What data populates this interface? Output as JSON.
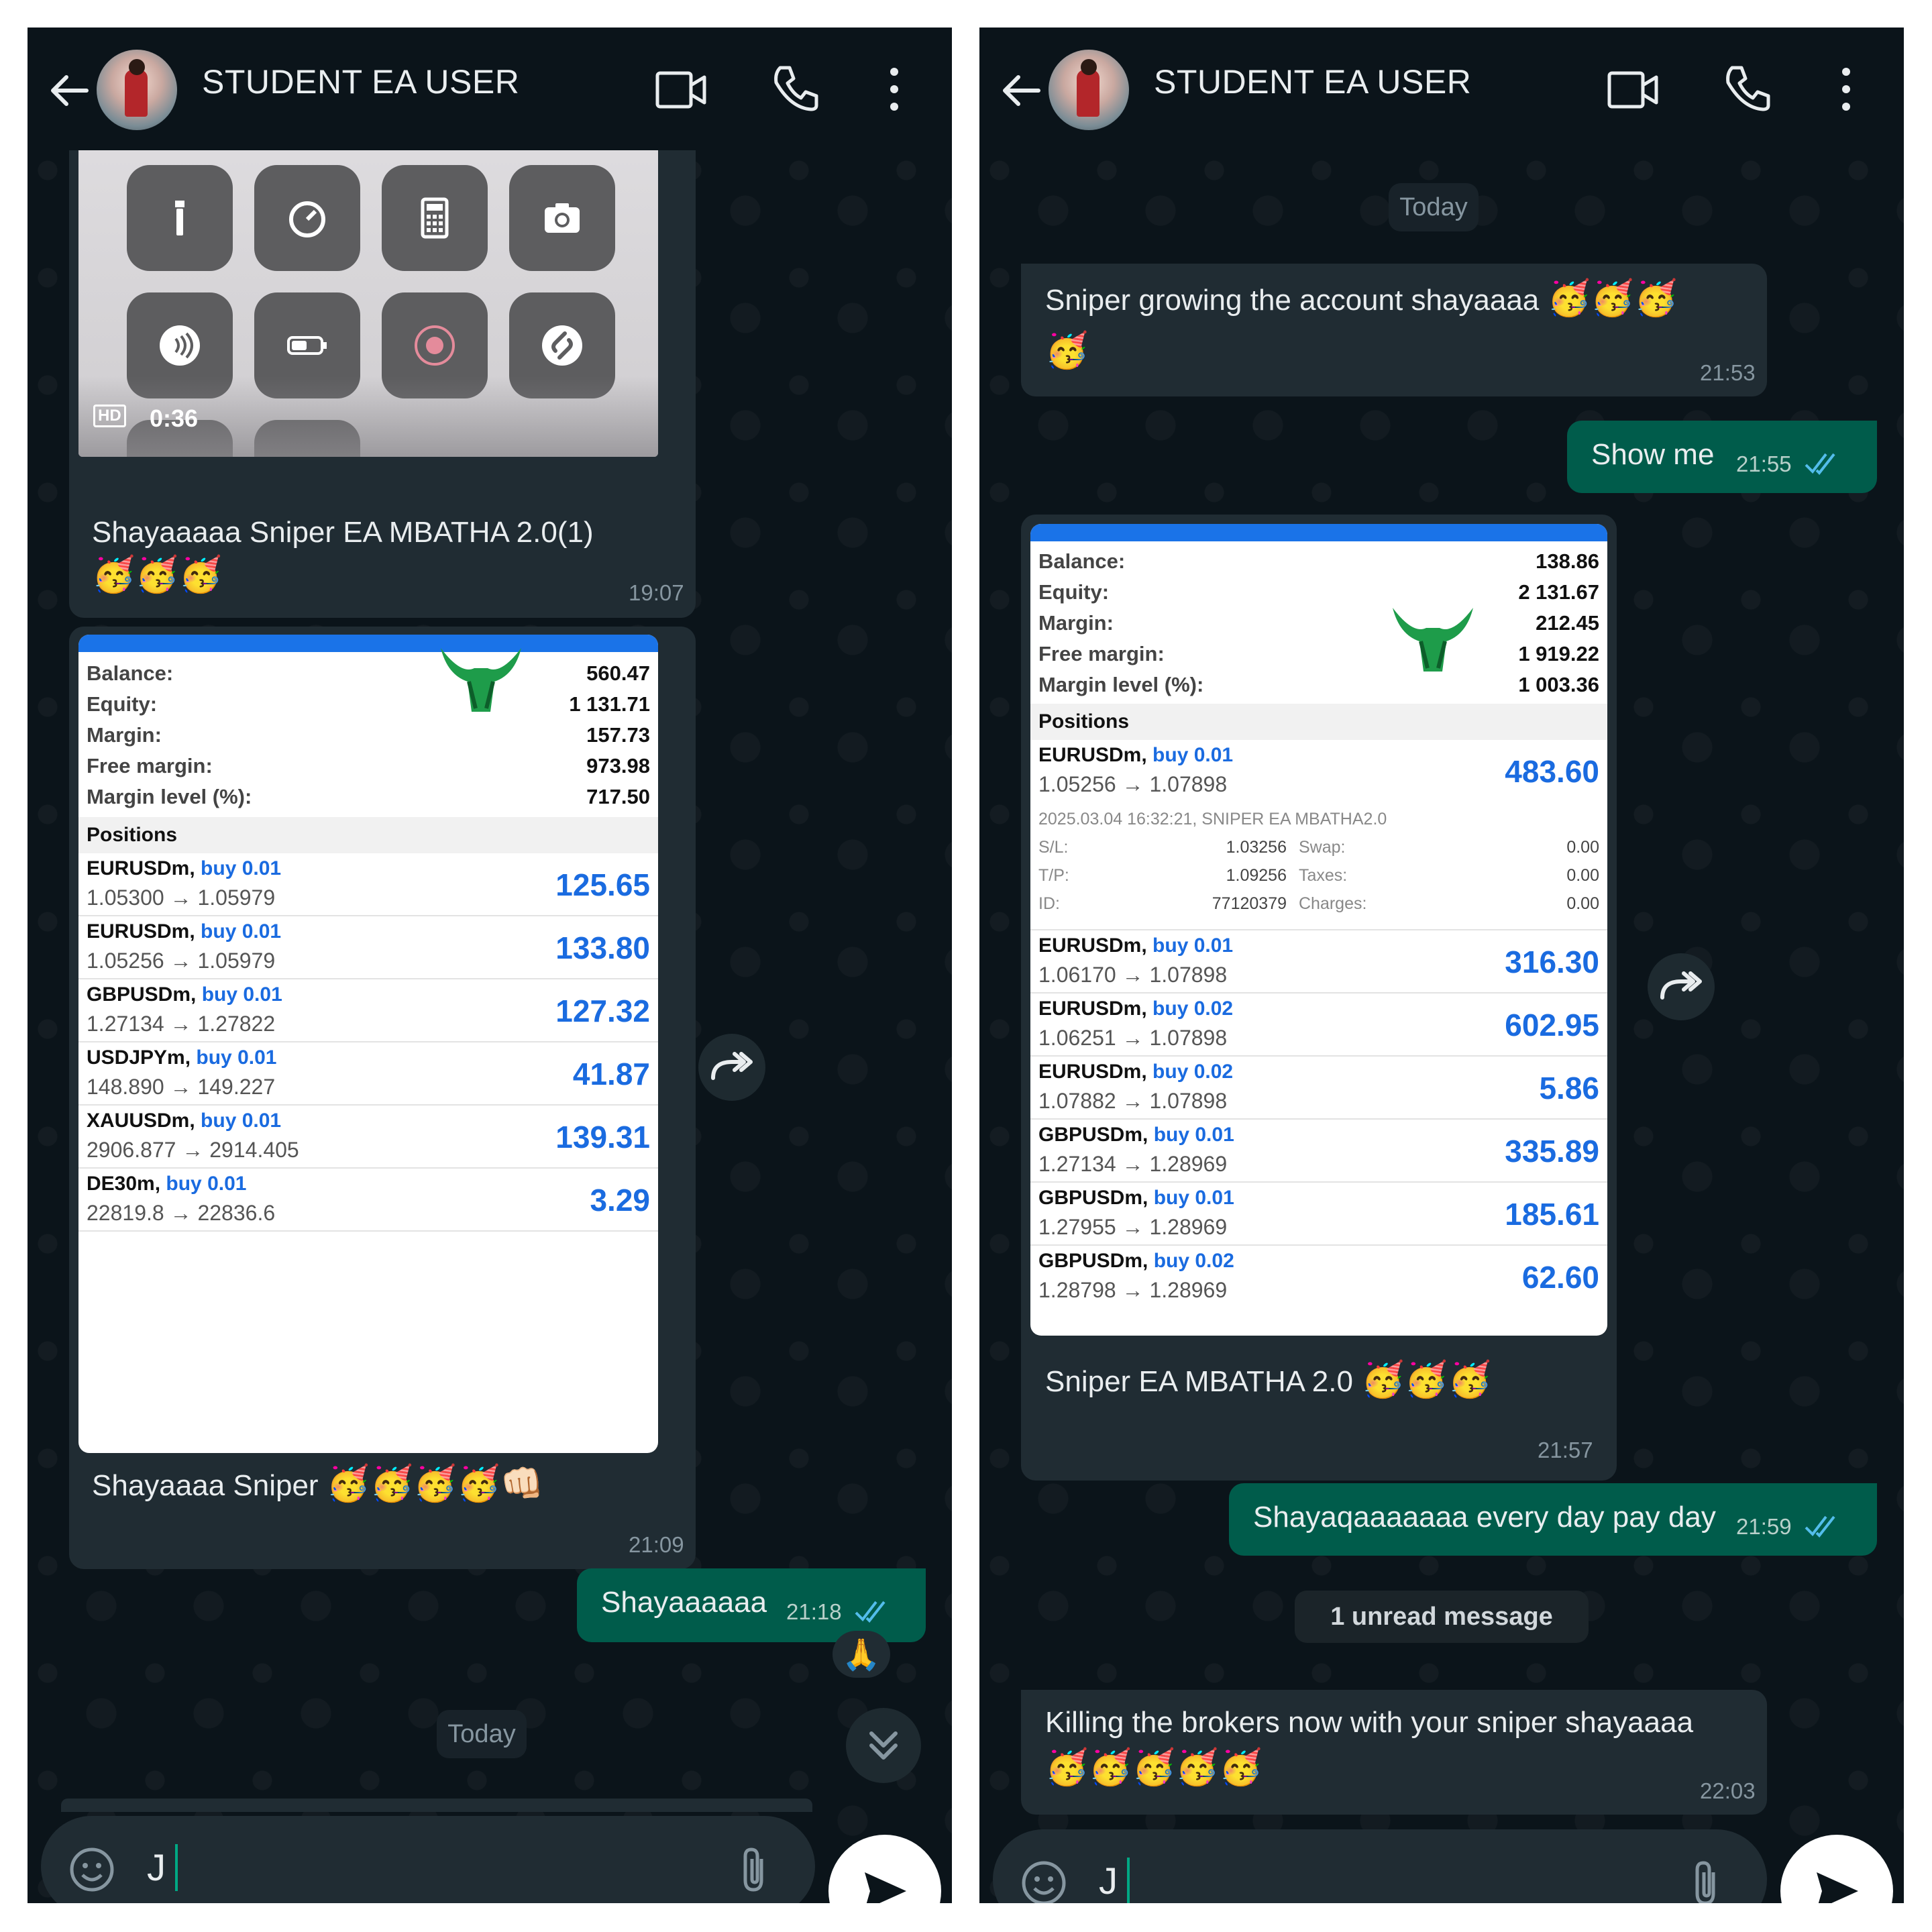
{
  "left": {
    "contact_name": "STUDENT EA USER",
    "video_message": {
      "hd_label": "HD",
      "duration": "0:36",
      "caption": "Shayaaaaa Sniper EA MBATHA 2.0(1)",
      "emojis": "🥳🥳🥳",
      "time": "19:07"
    },
    "screenshot_message": {
      "account": [
        {
          "label": "Balance:",
          "value": "560.47"
        },
        {
          "label": "Equity:",
          "value": "1 131.71"
        },
        {
          "label": "Margin:",
          "value": "157.73"
        },
        {
          "label": "Free margin:",
          "value": "973.98"
        },
        {
          "label": "Margin level (%):",
          "value": "717.50"
        }
      ],
      "positions_label": "Positions",
      "positions": [
        {
          "symbol": "EURUSDm,",
          "side": "buy 0.01",
          "prices": "1.05300 → 1.05979",
          "profit": "125.65"
        },
        {
          "symbol": "EURUSDm,",
          "side": "buy 0.01",
          "prices": "1.05256 → 1.05979",
          "profit": "133.80"
        },
        {
          "symbol": "GBPUSDm,",
          "side": "buy 0.01",
          "prices": "1.27134 → 1.27822",
          "profit": "127.32"
        },
        {
          "symbol": "USDJPYm,",
          "side": "buy 0.01",
          "prices": "148.890 → 149.227",
          "profit": "41.87"
        },
        {
          "symbol": "XAUUSDm,",
          "side": "buy 0.01",
          "prices": "2906.877 → 2914.405",
          "profit": "139.31"
        },
        {
          "symbol": "DE30m,",
          "side": "buy 0.01",
          "prices": "22819.8 → 22836.6",
          "profit": "3.29"
        }
      ],
      "caption": "Shayaaaa Sniper",
      "emojis": "🥳🥳🥳🥳👊🏻",
      "time": "21:09"
    },
    "outgoing_message": {
      "text": "Shayaaaaaa",
      "time": "21:18",
      "reaction": "🙏"
    },
    "date_chip": "Today",
    "input_text": "J"
  },
  "right": {
    "contact_name": "STUDENT EA USER",
    "date_chip": "Today",
    "msg1": {
      "text": "Sniper growing the account  shayaaaa",
      "emojis_line1": "🥳🥳🥳",
      "emojis_line2": "🥳",
      "time": "21:53"
    },
    "msg2": {
      "text": "Show me",
      "time": "21:55"
    },
    "screenshot_message": {
      "account": [
        {
          "label": "Balance:",
          "value": "138.86"
        },
        {
          "label": "Equity:",
          "value": "2 131.67"
        },
        {
          "label": "Margin:",
          "value": "212.45"
        },
        {
          "label": "Free margin:",
          "value": "1 919.22"
        },
        {
          "label": "Margin level (%):",
          "value": "1 003.36"
        }
      ],
      "positions_label": "Positions",
      "first_position": {
        "symbol": "EURUSDm,",
        "side": "buy 0.01",
        "prices": "1.05256 → 1.07898",
        "profit": "483.60"
      },
      "detail": {
        "opened": "2025.03.04 16:32:21, SNIPER EA  MBATHA2.0",
        "sl_label": "S/L:",
        "sl": "1.03256",
        "swap_label": "Swap:",
        "swap": "0.00",
        "tp_label": "T/P:",
        "tp": "1.09256",
        "taxes_label": "Taxes:",
        "taxes": "0.00",
        "id_label": "ID:",
        "id": "77120379",
        "charges_label": "Charges:",
        "charges": "0.00"
      },
      "positions": [
        {
          "symbol": "EURUSDm,",
          "side": "buy 0.01",
          "prices": "1.06170 → 1.07898",
          "profit": "316.30"
        },
        {
          "symbol": "EURUSDm,",
          "side": "buy 0.02",
          "prices": "1.06251 → 1.07898",
          "profit": "602.95"
        },
        {
          "symbol": "EURUSDm,",
          "side": "buy 0.02",
          "prices": "1.07882 → 1.07898",
          "profit": "5.86"
        },
        {
          "symbol": "GBPUSDm,",
          "side": "buy 0.01",
          "prices": "1.27134 → 1.28969",
          "profit": "335.89"
        },
        {
          "symbol": "GBPUSDm,",
          "side": "buy 0.01",
          "prices": "1.27955 → 1.28969",
          "profit": "185.61"
        },
        {
          "symbol": "GBPUSDm,",
          "side": "buy 0.02",
          "prices": "1.28798 → 1.28969",
          "profit": "62.60"
        }
      ],
      "caption": "Sniper EA MBATHA 2.0",
      "emojis": "🥳🥳🥳",
      "time": "21:57"
    },
    "msg3": {
      "text": "Shayaqaaaaaaa every day pay day",
      "time": "21:59"
    },
    "unread_banner": "1 unread message",
    "msg4": {
      "text": "Killing the brokers now with your sniper shayaaaa",
      "emojis": "🥳🥳🥳🥳🥳",
      "time": "22:03"
    },
    "input_text": "J"
  },
  "colors": {
    "background": "#0b141a",
    "incoming_bubble": "#202c33",
    "outgoing_bubble": "#005c4b",
    "read_ticks": "#53bdeb",
    "profit_blue": "#1a6be0",
    "mt_header_blue": "#1a73e8"
  },
  "icons": [
    "back-arrow-icon",
    "video-call-icon",
    "voice-call-icon",
    "more-options-icon",
    "forward-icon",
    "scroll-down-icon",
    "sticker-icon",
    "attach-icon",
    "send-icon",
    "read-ticks-icon"
  ]
}
